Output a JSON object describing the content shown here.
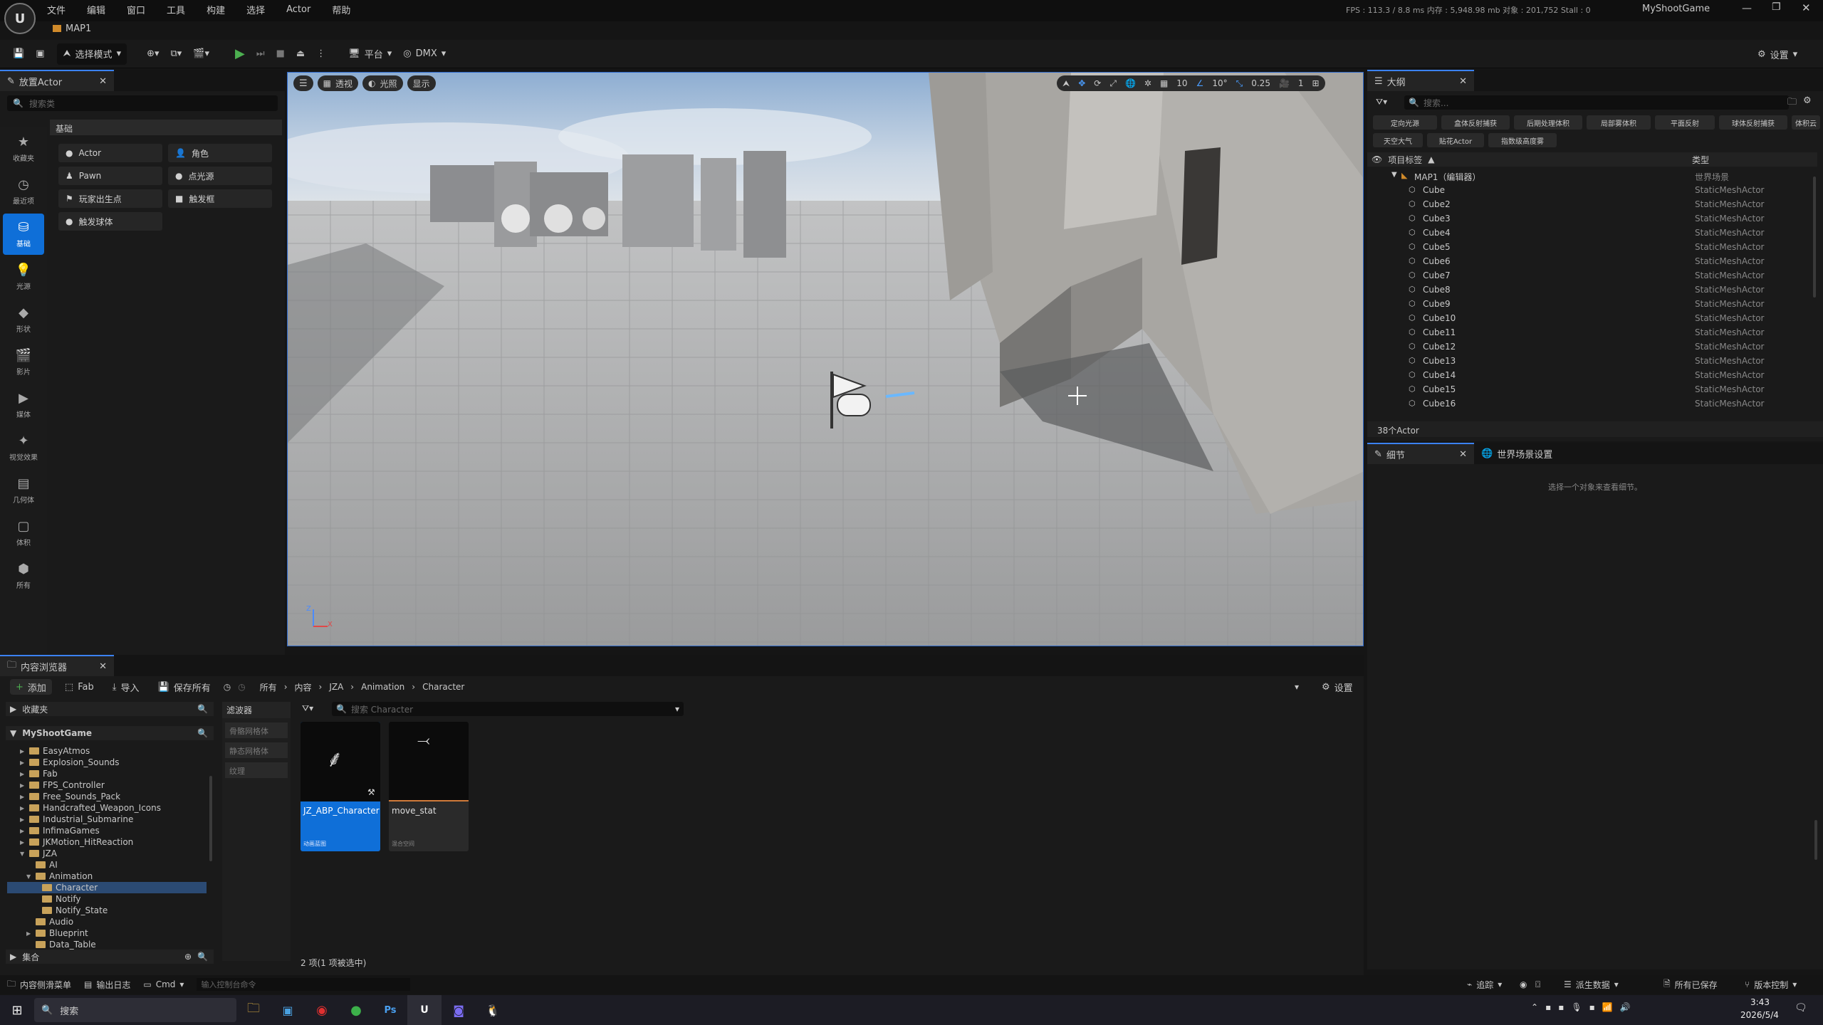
{
  "menu": [
    "文件",
    "编辑",
    "窗口",
    "工具",
    "构建",
    "选择",
    "Actor",
    "帮助"
  ],
  "stats": "FPS : 113.3 / 8.8 ms  内存 : 5,948.98 mb  对象 : 201,752  Stall : 0",
  "project_name": "MyShootGame",
  "map_tab": "MAP1",
  "toolbar": {
    "select_mode": "选择模式",
    "platform": "平台",
    "dmx": "DMX",
    "settings": "设置"
  },
  "place_actors": {
    "tab": "放置Actor",
    "search_placeholder": "搜索类",
    "section": "基础",
    "categories": [
      "收藏夹",
      "最近项",
      "基础",
      "光源",
      "形状",
      "影片",
      "媒体",
      "视觉效果",
      "几何体",
      "体积",
      "所有"
    ],
    "items": [
      "Actor",
      "角色",
      "Pawn",
      "点光源",
      "玩家出生点",
      "触发框",
      "触发球体"
    ]
  },
  "viewport": {
    "perspective": "透视",
    "lit": "光照",
    "show": "显示",
    "grid_snap": "10",
    "rot_snap": "10°",
    "scale_snap": "0.25",
    "cam_speed": "1",
    "axis_z": "Z",
    "axis_x": "X"
  },
  "outliner": {
    "tab": "大纲",
    "search_placeholder": "搜索...",
    "chips": [
      "定向光源",
      "盒体反射捕获",
      "后期处理体积",
      "局部雾体积",
      "平面反射",
      "球体反射捕获",
      "体积云",
      "天空大气",
      "贴花Actor",
      "指数级高度雾"
    ],
    "col_label": "项目标签",
    "col_type": "类型",
    "root": "MAP1（编辑器）",
    "root_type": "世界场景",
    "rows": [
      {
        "name": "Cube",
        "type": "StaticMeshActor"
      },
      {
        "name": "Cube2",
        "type": "StaticMeshActor"
      },
      {
        "name": "Cube3",
        "type": "StaticMeshActor"
      },
      {
        "name": "Cube4",
        "type": "StaticMeshActor"
      },
      {
        "name": "Cube5",
        "type": "StaticMeshActor"
      },
      {
        "name": "Cube6",
        "type": "StaticMeshActor"
      },
      {
        "name": "Cube7",
        "type": "StaticMeshActor"
      },
      {
        "name": "Cube8",
        "type": "StaticMeshActor"
      },
      {
        "name": "Cube9",
        "type": "StaticMeshActor"
      },
      {
        "name": "Cube10",
        "type": "StaticMeshActor"
      },
      {
        "name": "Cube11",
        "type": "StaticMeshActor"
      },
      {
        "name": "Cube12",
        "type": "StaticMeshActor"
      },
      {
        "name": "Cube13",
        "type": "StaticMeshActor"
      },
      {
        "name": "Cube14",
        "type": "StaticMeshActor"
      },
      {
        "name": "Cube15",
        "type": "StaticMeshActor"
      },
      {
        "name": "Cube16",
        "type": "StaticMeshActor"
      }
    ],
    "count": "38个Actor"
  },
  "details": {
    "tab": "细节",
    "world_tab": "世界场景设置",
    "empty": "选择一个对象来查看细节。"
  },
  "content": {
    "tab": "内容浏览器",
    "add": "添加",
    "fab": "Fab",
    "import": "导入",
    "save_all": "保存所有",
    "settings": "设置",
    "breadcrumb": [
      "所有",
      "内容",
      "JZA",
      "Animation",
      "Character"
    ],
    "favorites": "收藏夹",
    "project": "MyShootGame",
    "filters": "滤波器",
    "filter_items": [
      "骨骼网格体",
      "静态网格体",
      "纹理"
    ],
    "search_placeholder": "搜索 Character",
    "tree": [
      "EasyAtmos",
      "Explosion_Sounds",
      "Fab",
      "FPS_Controller",
      "Free_Sounds_Pack",
      "Handcrafted_Weapon_Icons",
      "Industrial_Submarine",
      "InfimaGames",
      "JKMotion_HitReaction",
      "JZA",
      "AI",
      "Animation",
      "Character",
      "Notify",
      "Notify_State",
      "Audio",
      "Blueprint",
      "Data_Table"
    ],
    "collections": "集合",
    "assets": [
      {
        "name": "JZ_ABP_Character",
        "type": "动画蓝图"
      },
      {
        "name": "move_stat",
        "type": "混合空间"
      }
    ],
    "status": "2 项(1 项被选中)"
  },
  "statusbar": {
    "drawer": "内容侧滑菜单",
    "log": "输出日志",
    "cmd": "Cmd",
    "cmd_placeholder": "输入控制台命令",
    "trace": "追踪",
    "derived": "派生数据",
    "saved": "所有已保存",
    "vc": "版本控制"
  },
  "taskbar": {
    "search": "搜索",
    "time": "3:43",
    "date": "2026/5/4"
  }
}
